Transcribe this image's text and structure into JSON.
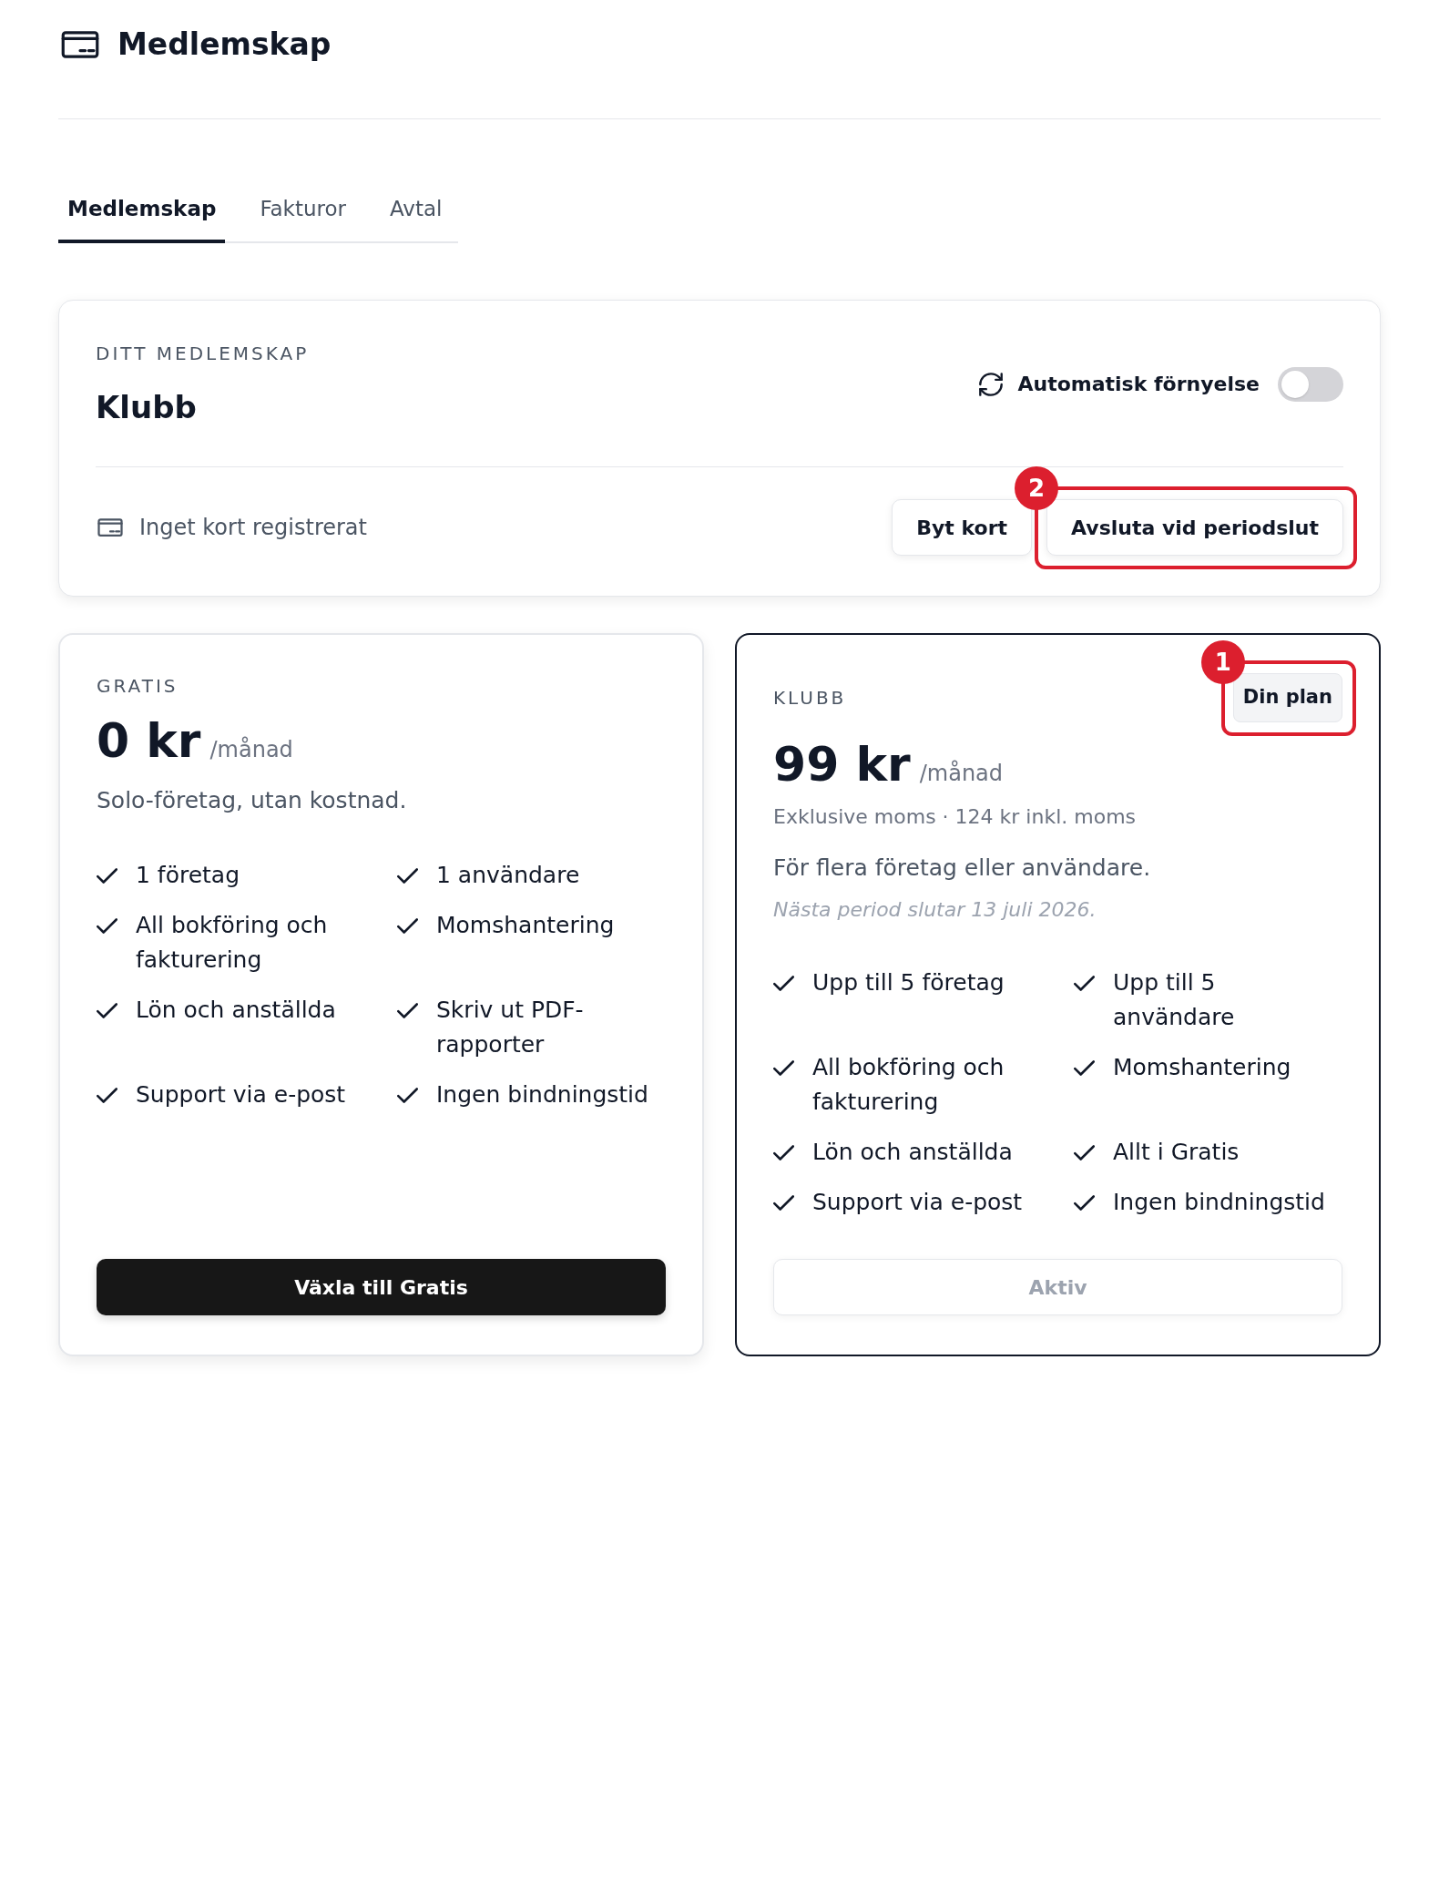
{
  "header": {
    "title": "Medlemskap"
  },
  "tabs": [
    {
      "label": "Medlemskap",
      "selected": true
    },
    {
      "label": "Fakturor",
      "selected": false
    },
    {
      "label": "Avtal",
      "selected": false
    }
  ],
  "membership": {
    "label": "DITT MEDLEMSKAP",
    "plan": "Klubb",
    "auto_renewal": {
      "label": "Automatisk förnyelse",
      "on": false
    },
    "card_status": "Inget kort registrerat",
    "buttons": [
      {
        "label": "Byt kort"
      },
      {
        "label": "Avsluta vid periodslut",
        "callout": "2"
      }
    ]
  },
  "plans": [
    {
      "name": "GRATIS",
      "selected": false,
      "price": "0 kr",
      "period": "/månad",
      "description": "Solo-företag, utan kostnad.",
      "features": [
        "1 företag",
        "1 användare",
        "All bokföring och fakturering",
        "Momshantering",
        "Lön och anställda",
        "Skriv ut PDF-rapporter",
        "Support via e-post",
        "Ingen bindningstid"
      ],
      "action": {
        "label": "Växla till Gratis",
        "disabled": false
      }
    },
    {
      "name": "KLUBB",
      "selected": true,
      "badge": {
        "label": "Din plan",
        "callout": "1"
      },
      "price": "99 kr",
      "period": "/månad",
      "vat_note": "Exklusive moms · 124 kr inkl. moms",
      "description": "För flera företag eller användare.",
      "renewal_note": "Nästa period slutar 13 juli 2026.",
      "features": [
        "Upp till 5 företag",
        "Upp till 5 användare",
        "All bokföring och fakturering",
        "Momshantering",
        "Lön och anställda",
        "Allt i Gratis",
        "Support via e-post",
        "Ingen bindningstid"
      ],
      "action": {
        "label": "Aktiv",
        "disabled": true
      }
    }
  ]
}
